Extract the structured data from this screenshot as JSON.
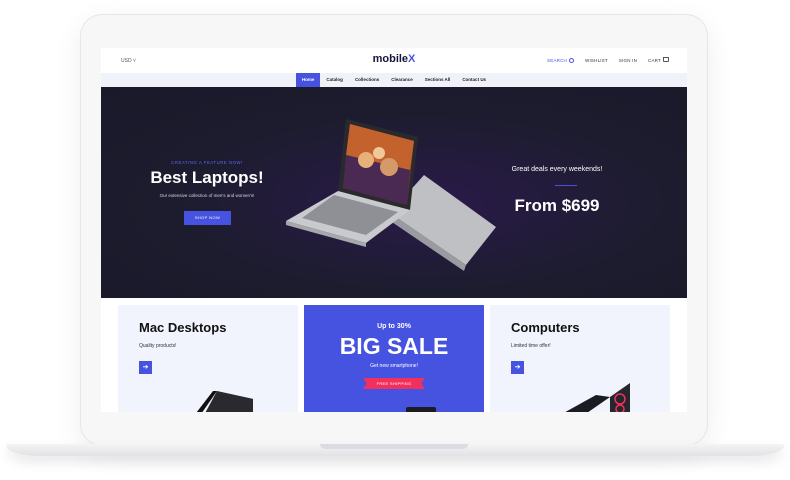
{
  "store": {
    "currency": "USD",
    "logo_main": "mobile",
    "logo_accent": "X"
  },
  "header": {
    "search": "SEARCH",
    "wishlist": "WISHLIST",
    "sign_in": "SIGN IN",
    "cart": "CART"
  },
  "nav": {
    "items": [
      "Home",
      "Catalog",
      "Collections",
      "Clearance",
      "Sections All",
      "Contact Us"
    ],
    "active": "Home"
  },
  "hero": {
    "eyebrow": "CREATING A FEATURE NOW!",
    "title": "Best Laptops!",
    "subtitle": "Our extensive collection of men's and women's!",
    "button": "SHOP NOW",
    "deals_text": "Great deals every weekends!",
    "price": "From $699"
  },
  "banners": [
    {
      "title": "Mac Desktops",
      "subtitle": "Quality products!",
      "arrow": "➔"
    },
    {
      "top": "Up to 30%",
      "title": "BIG SALE",
      "subtitle": "Get new smartphone!",
      "ribbon": "FREE SHIPPING"
    },
    {
      "title": "Computers",
      "subtitle": "Limited time offer!",
      "arrow": "➔"
    }
  ],
  "colors": {
    "accent": "#4653e0",
    "hero_bg": "#1c1c2e",
    "ribbon": "#f2305b",
    "banner_light": "#f1f3fd"
  }
}
